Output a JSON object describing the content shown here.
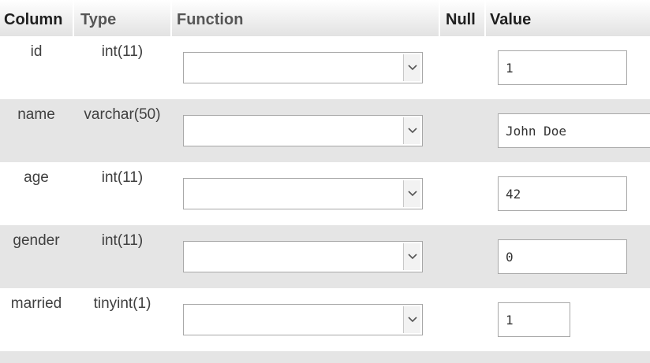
{
  "header": {
    "column": "Column",
    "type": "Type",
    "function": "Function",
    "null": "Null",
    "value": "Value"
  },
  "rows": [
    {
      "column": "id",
      "type": "int(11)",
      "function": "",
      "value": "1"
    },
    {
      "column": "name",
      "type": "varchar(50)",
      "function": "",
      "value": "John Doe"
    },
    {
      "column": "age",
      "type": "int(11)",
      "function": "",
      "value": "42"
    },
    {
      "column": "gender",
      "type": "int(11)",
      "function": "",
      "value": "0"
    },
    {
      "column": "married",
      "type": "tinyint(1)",
      "function": "",
      "value": "1"
    }
  ],
  "icons": {
    "dropdown": "chevron-down-icon"
  },
  "colors": {
    "row_stripe": "#e5e5e5",
    "border": "#a7a7a7"
  }
}
